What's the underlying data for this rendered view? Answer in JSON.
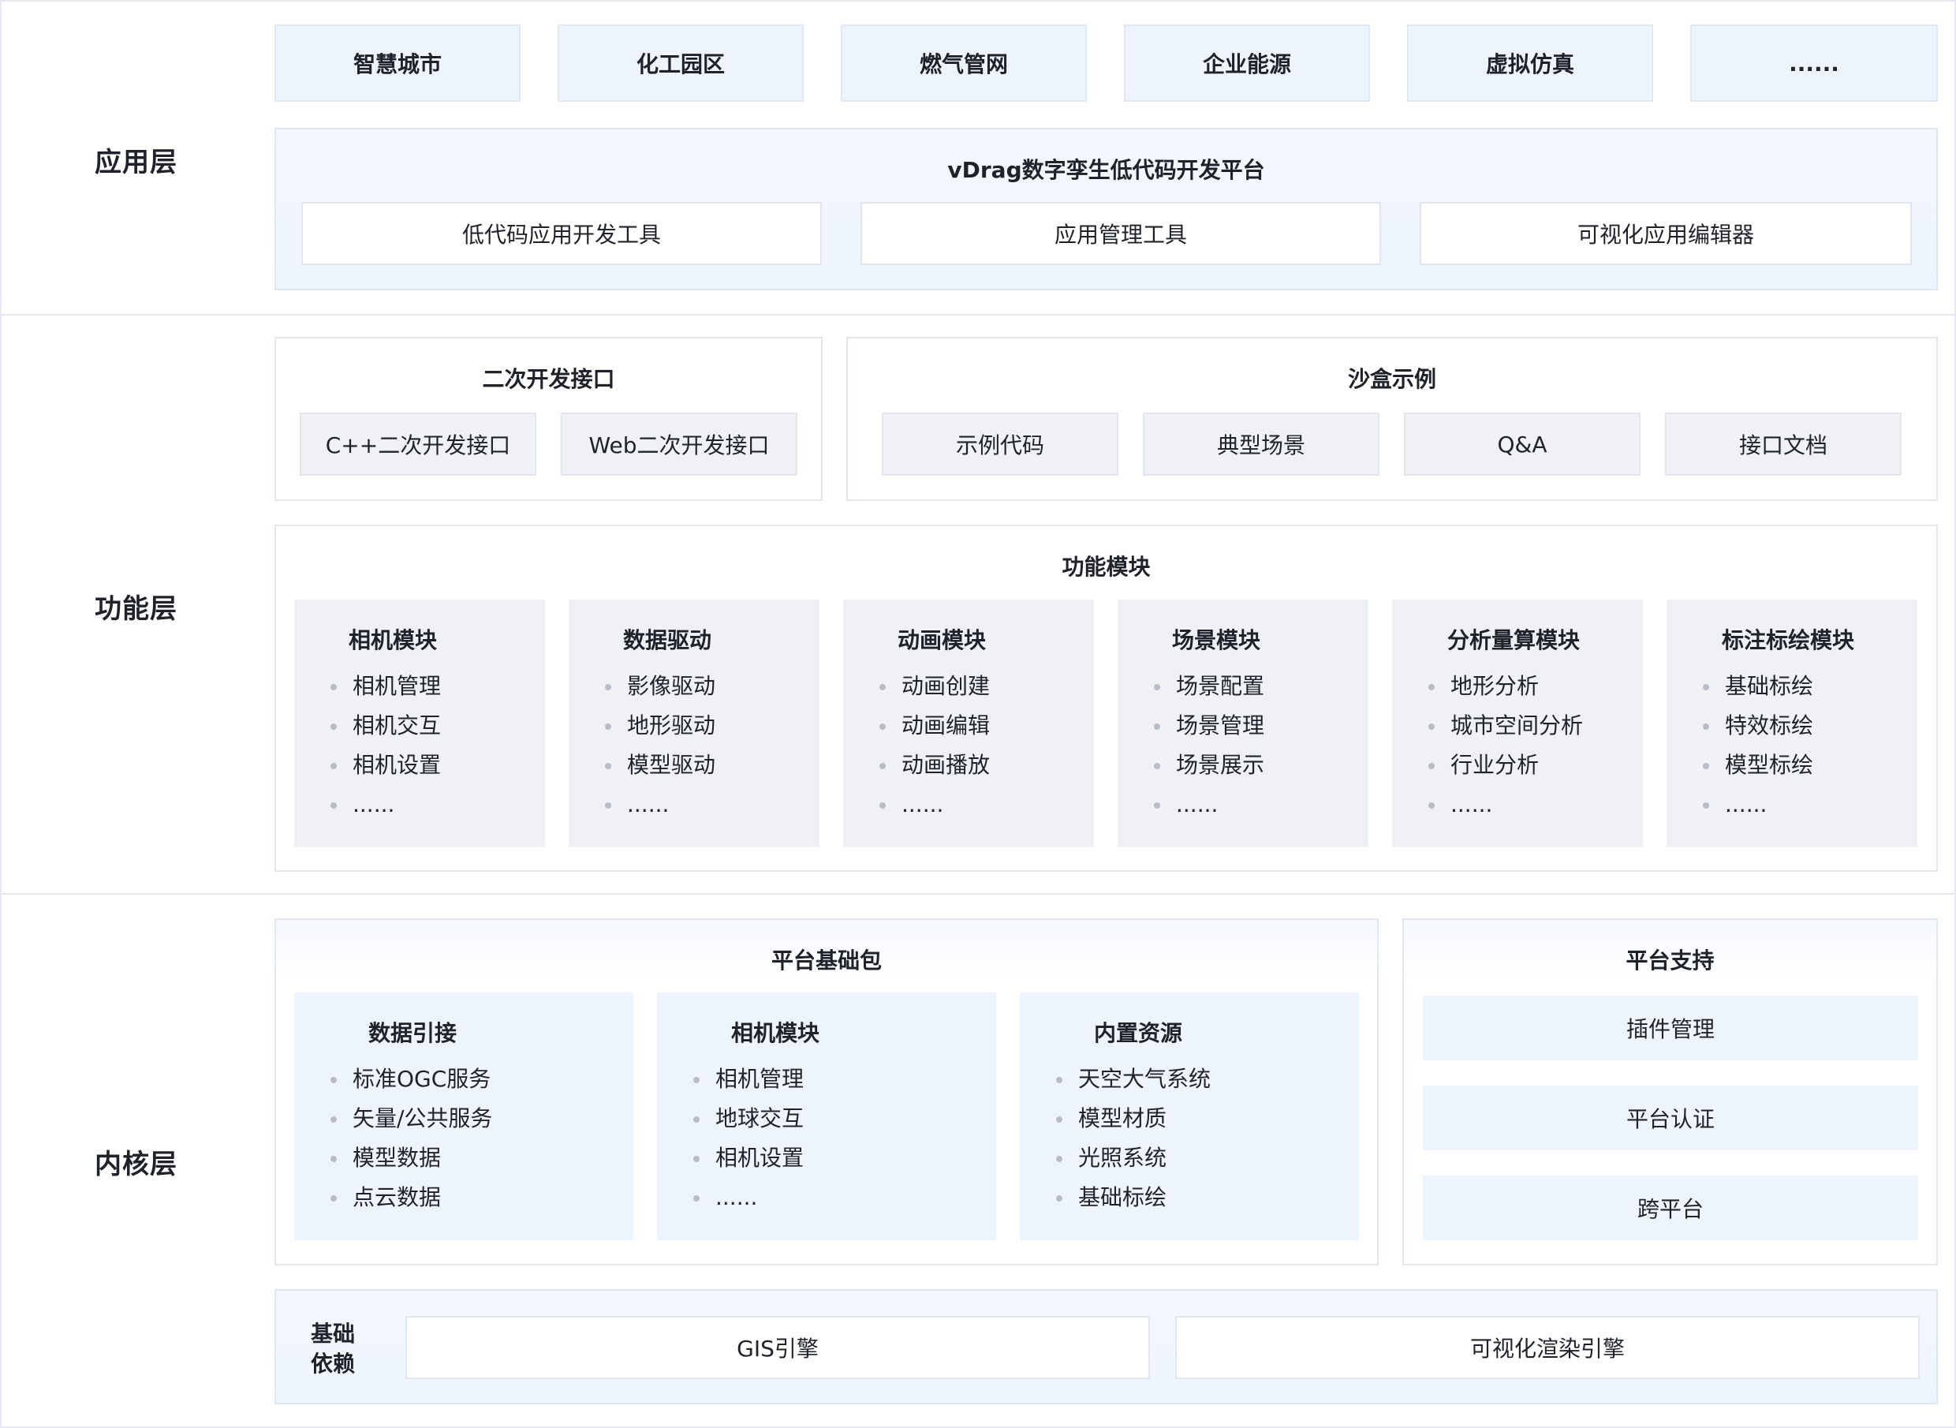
{
  "layers": {
    "app": "应用层",
    "func": "功能层",
    "core": "内核层"
  },
  "scenes": [
    "智慧城市",
    "化工园区",
    "燃气管网",
    "企业能源",
    "虚拟仿真",
    "......"
  ],
  "vdrag": {
    "title": "vDrag数字孪生低代码开发平台",
    "tools": [
      "低代码应用开发工具",
      "应用管理工具",
      "可视化应用编辑器"
    ]
  },
  "sdk": {
    "title": "二次开发接口",
    "items": [
      "C++二次开发接口",
      "Web二次开发接口"
    ]
  },
  "sandbox": {
    "title": "沙盒示例",
    "items": [
      "示例代码",
      "典型场景",
      "Q&A",
      "接口文档"
    ]
  },
  "modules": {
    "title": "功能模块",
    "cards": [
      {
        "title": "相机模块",
        "items": [
          "相机管理",
          "相机交互",
          "相机设置",
          "......"
        ]
      },
      {
        "title": "数据驱动",
        "items": [
          "影像驱动",
          "地形驱动",
          "模型驱动",
          "......"
        ]
      },
      {
        "title": "动画模块",
        "items": [
          "动画创建",
          "动画编辑",
          "动画播放",
          "......"
        ]
      },
      {
        "title": "场景模块",
        "items": [
          "场景配置",
          "场景管理",
          "场景展示",
          "......"
        ]
      },
      {
        "title": "分析量算模块",
        "items": [
          "地形分析",
          "城市空间分析",
          "行业分析",
          "......"
        ]
      },
      {
        "title": "标注标绘模块",
        "items": [
          "基础标绘",
          "特效标绘",
          "模型标绘",
          "......"
        ]
      }
    ]
  },
  "base_pkg": {
    "title": "平台基础包",
    "cards": [
      {
        "title": "数据引接",
        "items": [
          "标准OGC服务",
          "矢量/公共服务",
          "模型数据",
          "点云数据"
        ]
      },
      {
        "title": "相机模块",
        "items": [
          "相机管理",
          "地球交互",
          "相机设置",
          "......"
        ]
      },
      {
        "title": "内置资源",
        "items": [
          "天空大气系统",
          "模型材质",
          "光照系统",
          "基础标绘"
        ]
      }
    ]
  },
  "support": {
    "title": "平台支持",
    "items": [
      "插件管理",
      "平台认证",
      "跨平台"
    ]
  },
  "deps": {
    "label_line1": "基础",
    "label_line2": "依赖",
    "items": [
      "GIS引擎",
      "可视化渲染引擎"
    ]
  }
}
